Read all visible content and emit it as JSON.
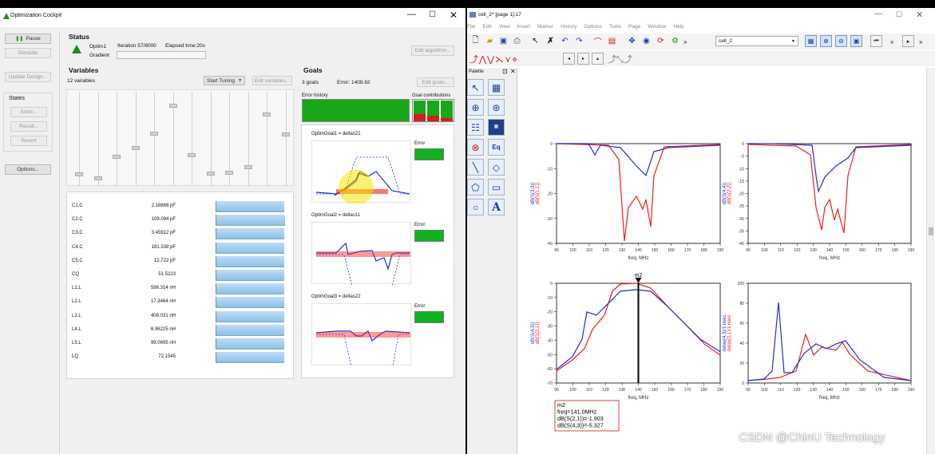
{
  "cockpit": {
    "title": "Optimization Cockpit",
    "buttons": {
      "pause": "Pause",
      "simulate": "Simulate",
      "update_design": "Update Design...",
      "store": "Store...",
      "recall": "Recall...",
      "revert": "Revert",
      "options": "Options...",
      "edit_algorithm": "Edit algorithm...",
      "start_tuning": "Start Tuning",
      "edit_variables": "Edit variables...",
      "edit_goals": "Edit goals..."
    },
    "states_label": "States",
    "status": {
      "heading": "Status",
      "optim": "Optim1",
      "iteration": "Iteration 57/8000",
      "elapsed": "Elapsed time:20s",
      "gradient": "Gradient"
    },
    "variables": {
      "heading": "Variables",
      "count": "12 variables",
      "slider_positions": [
        0.92,
        0.96,
        0.72,
        0.62,
        0.45,
        0.14,
        0.7,
        0.91,
        0.9,
        0.84,
        0.24,
        0.46
      ],
      "rows": [
        {
          "name": "C1.C",
          "value": "2.18866 pF",
          "fill": 0.92
        },
        {
          "name": "C2.C",
          "value": "109.094 pF",
          "fill": 0.93
        },
        {
          "name": "C3.C",
          "value": "3.45912 pF",
          "fill": 0.92
        },
        {
          "name": "C4.C",
          "value": "181.538 pF",
          "fill": 0.92
        },
        {
          "name": "C5.C",
          "value": "12.722 pF",
          "fill": 0.92
        },
        {
          "name": "CQ",
          "value": "51.5223",
          "fill": 0.92
        },
        {
          "name": "L1.L",
          "value": "596.314 nH",
          "fill": 0.92
        },
        {
          "name": "L2.L",
          "value": "17.3464 nH",
          "fill": 0.92
        },
        {
          "name": "L3.L",
          "value": "406.031 nH",
          "fill": 0.92
        },
        {
          "name": "L4.L",
          "value": "6.96225 nH",
          "fill": 0.92
        },
        {
          "name": "L5.L",
          "value": "99.0695 nH",
          "fill": 0.92
        },
        {
          "name": "LQ",
          "value": "72.1545",
          "fill": 0.92
        }
      ]
    },
    "goals": {
      "heading": "Goals",
      "count": "3 goals",
      "error": "Error:   1409.62",
      "error_history": "Error history",
      "goal_contributions": "Goal contributions",
      "items": [
        {
          "name": "OptimGoal1 = deltas21",
          "error_label": "Error"
        },
        {
          "name": "OptimGoal2 = deltas11",
          "error_label": "Error"
        },
        {
          "name": "OptimGoal3 = deltas22",
          "error_label": "Error"
        }
      ]
    }
  },
  "ads": {
    "title": "cell_2* [page 1]:17",
    "menu": [
      "File",
      "Edit",
      "View",
      "Insert",
      "Marker",
      "History",
      "Options",
      "Tools",
      "Page",
      "Window",
      "Help"
    ],
    "cell_select": "cell_2",
    "palette_label": "Palette",
    "plots": [
      {
        "ylabels": [
          "dB(S(3,3))",
          "dB(S(1,1))"
        ],
        "yticks": [
          "0",
          "-10",
          "-20",
          "-30",
          "-40"
        ],
        "xticks": [
          "90",
          "100",
          "110",
          "120",
          "130",
          "140",
          "150",
          "160",
          "170",
          "180",
          "190"
        ],
        "xlabel": "freq, MHz"
      },
      {
        "ylabels": [
          "dB(S(4,4))",
          "dB(S(2,2))"
        ],
        "yticks": [
          "0",
          "-5",
          "-10",
          "-15",
          "-20",
          "-25",
          "-30",
          "-35",
          "-40"
        ],
        "xticks": [
          "90",
          "100",
          "110",
          "120",
          "130",
          "140",
          "150",
          "160",
          "170",
          "180",
          "190"
        ],
        "xlabel": "freq, MHz"
      },
      {
        "ylabels": [
          "dB(S(4,3))",
          "dB(S(2,1))"
        ],
        "yticks": [
          "0",
          "-10",
          "-20",
          "-30",
          "-40",
          "-50",
          "-60",
          "-70"
        ],
        "xticks": [
          "90",
          "100",
          "110",
          "120",
          "130",
          "140",
          "150",
          "160",
          "170",
          "180",
          "190"
        ],
        "xlabel": "freq, MHz"
      },
      {
        "ylabels": [
          "delay(4,3)/1 nsec",
          "delay(2,1)/1 nsec"
        ],
        "yticks": [
          "100",
          "80",
          "60",
          "40",
          "20",
          "0"
        ],
        "xticks": [
          "90",
          "100",
          "110",
          "120",
          "130",
          "140",
          "150",
          "160",
          "170",
          "180",
          "190"
        ],
        "xlabel": "freq, MHz"
      }
    ],
    "marker": {
      "name": "m2",
      "lines": [
        "m2",
        "freq=141.0MHz",
        "dB(S(2,1))=-1.903",
        "dB(S(4,3))=-5.327"
      ]
    },
    "watermark": "CSDN @ChinU Technology",
    "colors": {
      "blue": "#1f2fd6",
      "red": "#e8231c",
      "green": "#0fb31f"
    }
  }
}
